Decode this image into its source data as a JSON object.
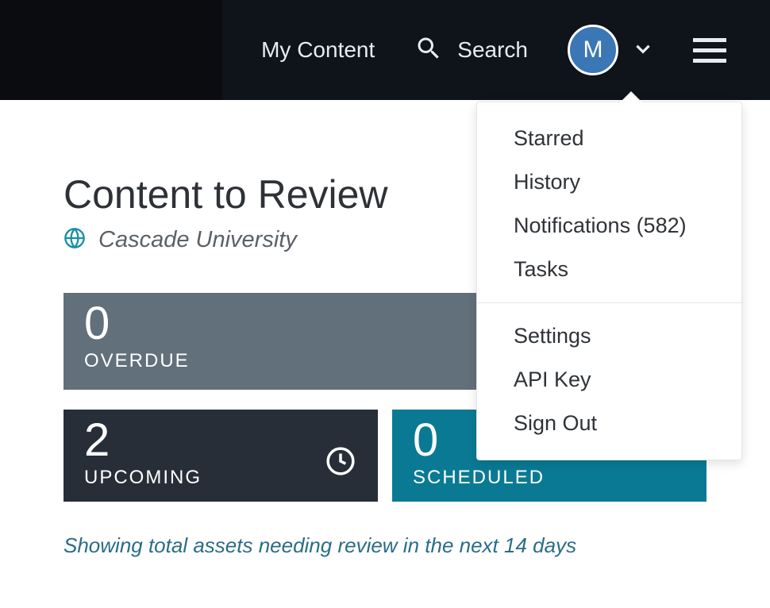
{
  "topbar": {
    "my_content": "My Content",
    "search_label": "Search",
    "avatar_initial": "M"
  },
  "dropdown": {
    "items_a": [
      "Starred",
      "History",
      "Notifications (582)",
      "Tasks"
    ],
    "items_b": [
      "Settings",
      "API Key",
      "Sign Out"
    ]
  },
  "page": {
    "title": "Content to Review",
    "subtitle": "Cascade University",
    "footnote": "Showing total assets needing review in the next 14 days"
  },
  "cards": {
    "overdue": {
      "value": "0",
      "label": "OVERDUE"
    },
    "upcoming": {
      "value": "2",
      "label": "UPCOMING"
    },
    "scheduled": {
      "value": "0",
      "label": "SCHEDULED"
    }
  }
}
